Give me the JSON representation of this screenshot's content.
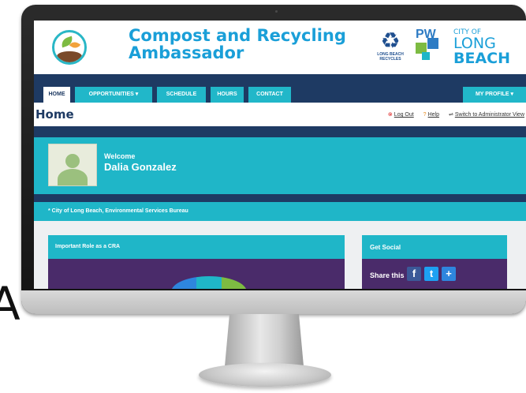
{
  "stray_letter": "A",
  "site": {
    "title_line1": "Compost and Recycling",
    "title_line2": "Ambassador",
    "logos": {
      "recycle_caption": "LONG BEACH RECYCLES",
      "pw_text": "PW",
      "city_line1": "CITY OF",
      "city_line2": "LONG",
      "city_line3": "BEACH"
    }
  },
  "nav": {
    "items": [
      {
        "label": "HOME",
        "active": true
      },
      {
        "label": "OPPORTUNITIES ▾",
        "active": false
      },
      {
        "label": "SCHEDULE",
        "active": false
      },
      {
        "label": "HOURS",
        "active": false
      },
      {
        "label": "CONTACT",
        "active": false
      }
    ],
    "profile_label": "MY PROFILE ▾"
  },
  "page": {
    "title": "Home",
    "links": {
      "logout": "Log Out",
      "help": "Help",
      "switch_view": "Switch to Administrator View"
    }
  },
  "welcome": {
    "label": "Welcome",
    "name": "Dalia Gonzalez"
  },
  "bureau": {
    "text": "* City of Long Beach, Environmental Services Bureau"
  },
  "panels": {
    "cra_title": "Important Role as a CRA",
    "social_title": "Get Social",
    "share_label": "Share this",
    "share_buttons": [
      "f",
      "t",
      "+"
    ]
  },
  "colors": {
    "navy": "#1e3a63",
    "teal": "#1fb6c8",
    "purple": "#4a2b6a",
    "title_blue": "#1a9fd8",
    "facebook": "#3b5998",
    "twitter": "#1da1f2",
    "share_plus": "#2e86de"
  }
}
